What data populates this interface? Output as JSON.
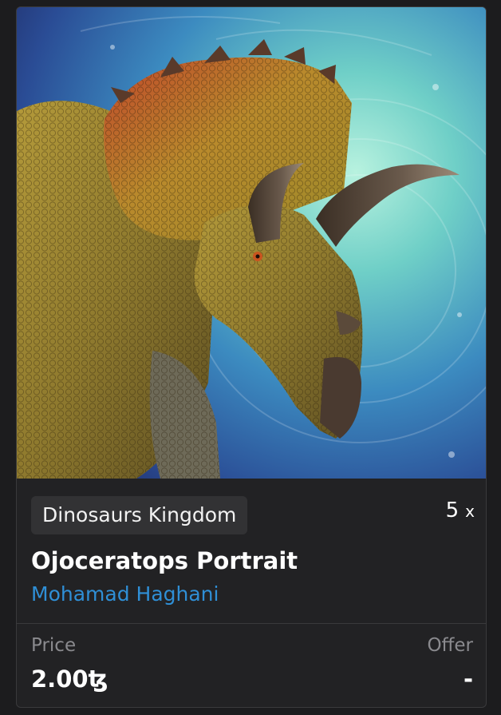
{
  "artwork": {
    "subject": "triceratops-like dinosaur portrait",
    "background_colors": [
      "#9be7d7",
      "#3f8fbe",
      "#23346f"
    ]
  },
  "card": {
    "collection_name": "Dinosaurs Kingdom",
    "edition_count": "5",
    "edition_suffix": "x",
    "title": "Ojoceratops Portrait",
    "artist": "Mohamad Haghani",
    "price_label": "Price",
    "price_value": "2.00ꜩ",
    "offer_label": "Offer",
    "offer_value": "-"
  },
  "colors": {
    "artist_link": "#2f8fd6",
    "card_bg": "#222224",
    "tag_bg": "#323234"
  }
}
